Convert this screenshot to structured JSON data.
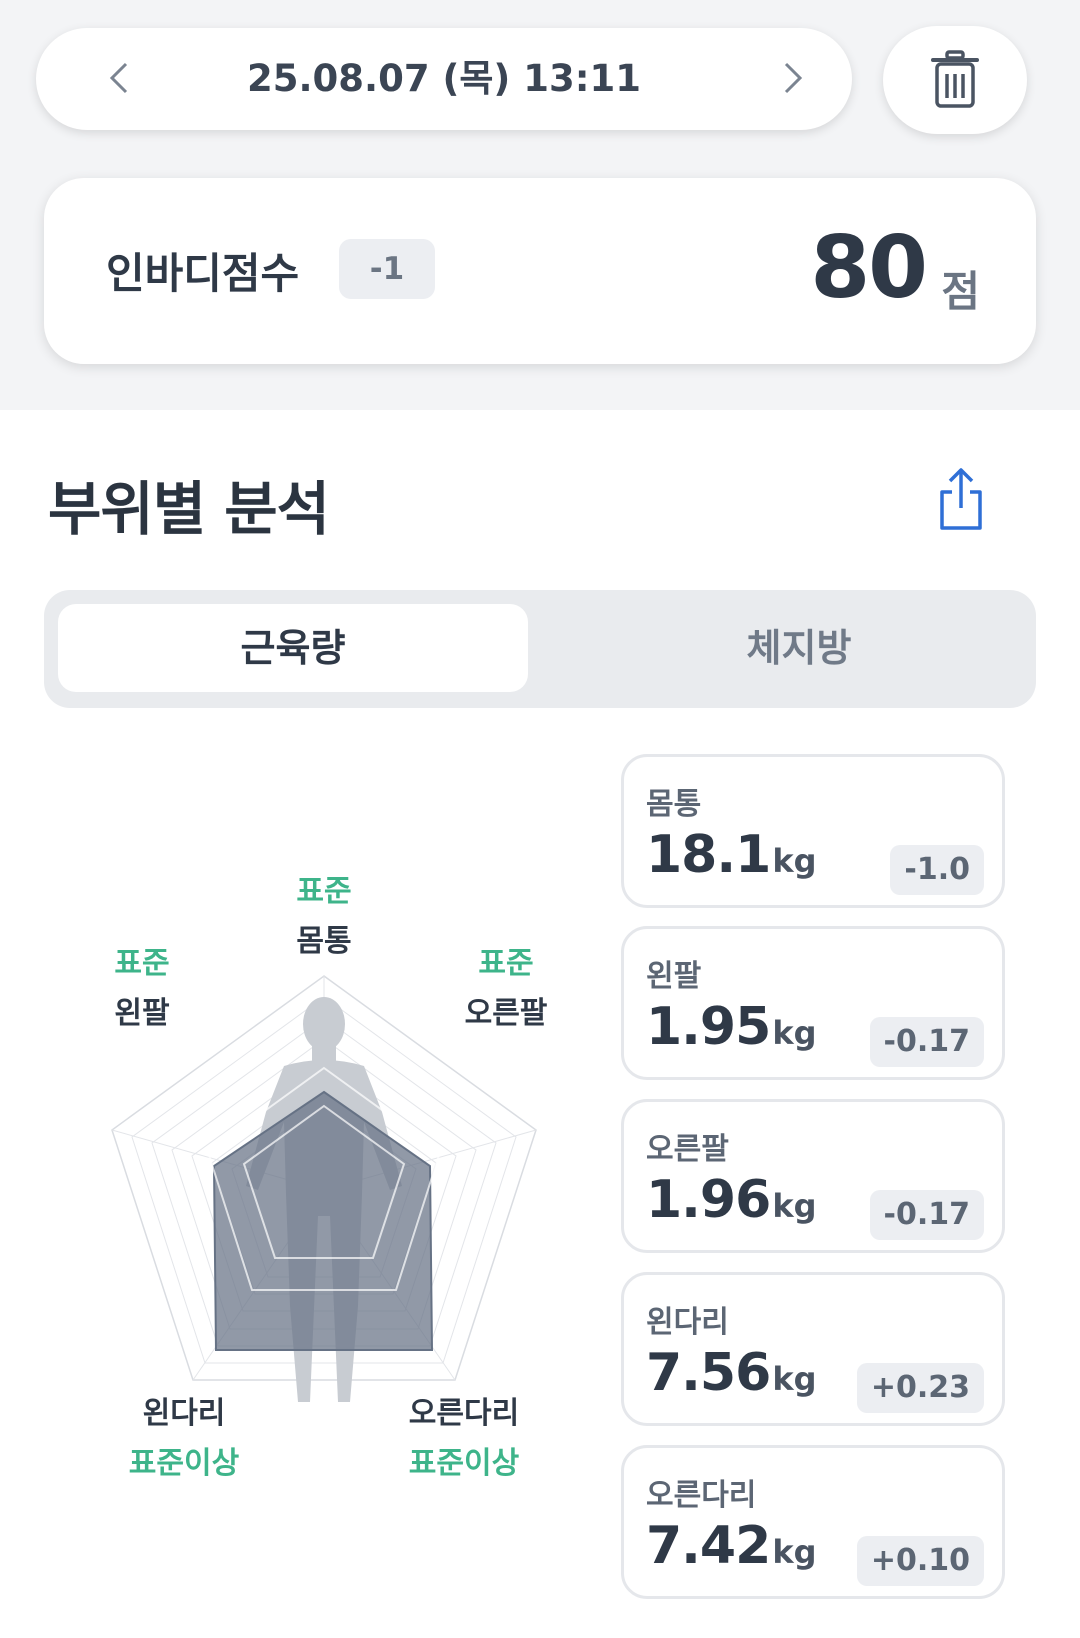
{
  "header": {
    "date": "25.08.07 (목) 13:11"
  },
  "score": {
    "label": "인바디점수",
    "delta": "-1",
    "value": "80",
    "unit": "점"
  },
  "section": {
    "title": "부위별 분석"
  },
  "toggle": {
    "active": "근육량",
    "inactive": "체지방"
  },
  "radar": {
    "labels": [
      {
        "part": "몸통",
        "status": "표준"
      },
      {
        "part": "왼팔",
        "status": "표준"
      },
      {
        "part": "오른팔",
        "status": "표준"
      },
      {
        "part": "왼다리",
        "status": "표준이상"
      },
      {
        "part": "오른다리",
        "status": "표준이상"
      }
    ]
  },
  "cards": [
    {
      "name": "몸통",
      "value": "18.1",
      "unit": "kg",
      "delta": "-1.0"
    },
    {
      "name": "왼팔",
      "value": "1.95",
      "unit": "kg",
      "delta": "-0.17"
    },
    {
      "name": "오른팔",
      "value": "1.96",
      "unit": "kg",
      "delta": "-0.17"
    },
    {
      "name": "왼다리",
      "value": "7.56",
      "unit": "kg",
      "delta": "+0.23"
    },
    {
      "name": "오른다리",
      "value": "7.42",
      "unit": "kg",
      "delta": "+0.10"
    }
  ],
  "colors": {
    "status_green": "#3eb48a",
    "accent_blue": "#2f6fd6",
    "radar_fill": "#667285"
  },
  "icons": [
    "chevron-left-icon",
    "chevron-right-icon",
    "trash-icon",
    "share-icon",
    "body-silhouette"
  ]
}
